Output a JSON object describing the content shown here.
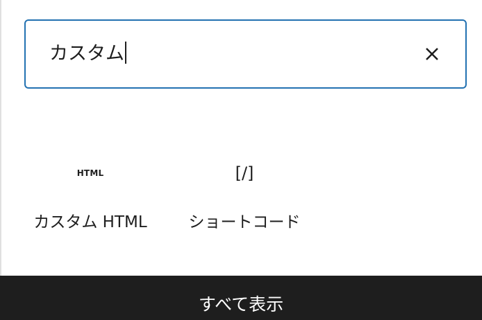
{
  "search": {
    "value": "カスタム",
    "clear_icon": "close-icon"
  },
  "blocks": [
    {
      "label": "カスタム HTML",
      "icon_text": "HTML",
      "icon": "html-icon"
    },
    {
      "label": "ショートコード",
      "icon_text": "[/]",
      "icon": "shortcode-icon"
    }
  ],
  "footer": {
    "label": "すべて表示"
  },
  "colors": {
    "accent": "#2271b1",
    "text": "#1e1e1e",
    "footer_bg": "#1e1e1e"
  }
}
